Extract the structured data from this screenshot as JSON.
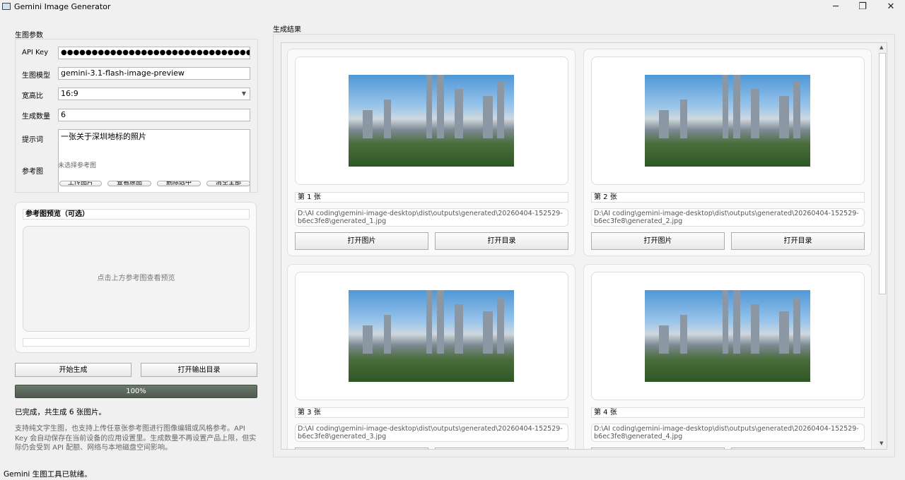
{
  "window": {
    "title": "Gemini Image Generator",
    "minimize": "─",
    "maximize": "❐",
    "close": "✕"
  },
  "params": {
    "title": "生图参数",
    "api_key_label": "API Key",
    "api_key_value": "●●●●●●●●●●●●●●●●●●●●●●●●●●●●●●●●●●●●●●●",
    "model_label": "生图模型",
    "model_value": "gemini-3.1-flash-image-preview",
    "ratio_label": "宽高比",
    "ratio_value": "16:9",
    "count_label": "生成数量",
    "count_value": "6",
    "prompt_label": "提示词",
    "prompt_value": "一张关于深圳地标的照片",
    "ref_label": "参考图",
    "ref_status": "未选择参考图",
    "ref_buttons": [
      "上传图片",
      "查看原图",
      "删除选中",
      "清空全部"
    ]
  },
  "preview": {
    "title": "参考图预览（可选）",
    "placeholder": "点击上方参考图查看预览"
  },
  "actions": {
    "start": "开始生成",
    "open_output": "打开输出目录"
  },
  "progress": {
    "percent": 100,
    "label": "100%"
  },
  "status": "已完成，共生成 6 张图片。",
  "help": "支持纯文字生图，也支持上传任意张参考图进行图像编辑或风格参考。API Key 会自动保存在当前设备的应用设置里。生成数量不再设置产品上限，但实际仍会受到 API 配额、网络与本地磁盘空间影响。",
  "statusbar": "Gemini 生图工具已就绪。",
  "results": {
    "title": "生成结果",
    "open_image": "打开图片",
    "open_dir": "打开目录",
    "items": [
      {
        "name": "第 1 张",
        "path": "D:\\AI coding\\gemini-image-desktop\\dist\\outputs\\generated\\20260404-152529-b6ec3fe8\\generated_1.jpg"
      },
      {
        "name": "第 2 张",
        "path": "D:\\AI coding\\gemini-image-desktop\\dist\\outputs\\generated\\20260404-152529-b6ec3fe8\\generated_2.jpg"
      },
      {
        "name": "第 3 张",
        "path": "D:\\AI coding\\gemini-image-desktop\\dist\\outputs\\generated\\20260404-152529-b6ec3fe8\\generated_3.jpg"
      },
      {
        "name": "第 4 张",
        "path": "D:\\AI coding\\gemini-image-desktop\\dist\\outputs\\generated\\20260404-152529-b6ec3fe8\\generated_4.jpg"
      }
    ]
  }
}
